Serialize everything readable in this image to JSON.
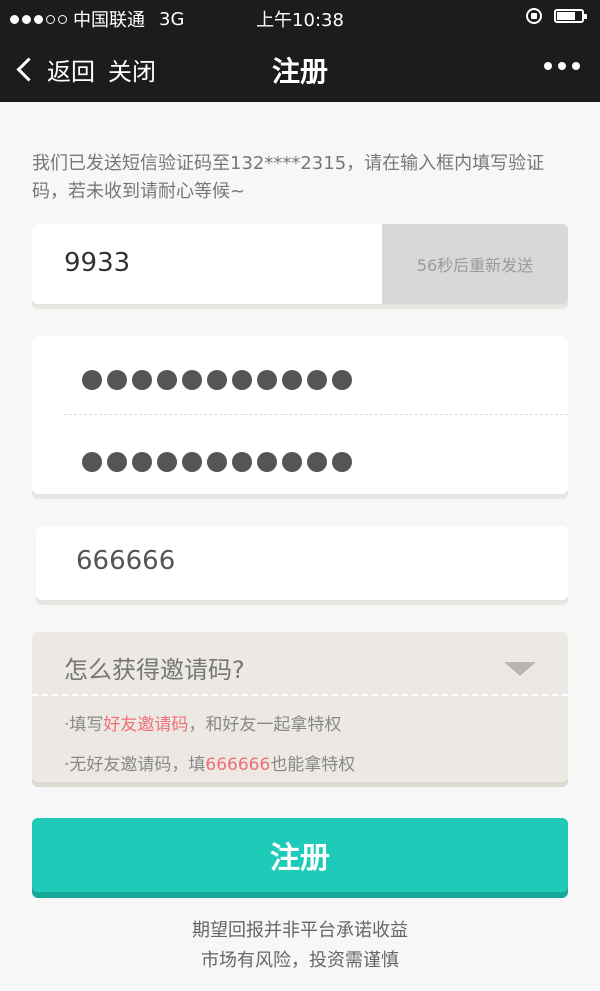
{
  "status_bar": {
    "carrier": "中国联通",
    "network": "3G",
    "time": "上午10:38"
  },
  "nav": {
    "back_label": "返回",
    "close_label": "关闭",
    "title": "注册"
  },
  "sms_notice": "我们已发送短信验证码至132****2315，请在输入框内填写验证码，若未收到请耐心等候~",
  "verification": {
    "code_value": "9933",
    "resend_label": "56秒后重新发送"
  },
  "password": {
    "masked_char_count": 11
  },
  "invite": {
    "code_value": "666666"
  },
  "howto": {
    "title": "怎么获得邀请码?",
    "tip1_prefix": "·填写",
    "tip1_highlight": "好友邀请码",
    "tip1_suffix": "，和好友一起拿特权",
    "tip2_prefix": "·无好友邀请码，填",
    "tip2_highlight": "666666",
    "tip2_suffix": "也能拿特权"
  },
  "register_button_label": "注册",
  "disclaimer": {
    "line1": "期望回报并非平台承诺收益",
    "line2": "市场有风险，投资需谨慎"
  },
  "colors": {
    "accent": "#1ecbb8",
    "highlight": "#ef6f78",
    "navbar": "#1c1c1e"
  }
}
